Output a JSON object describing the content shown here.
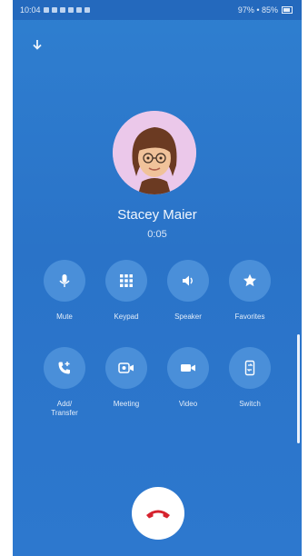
{
  "status_bar": {
    "time": "10:04",
    "right_text": "97% • 85%"
  },
  "caller": {
    "name": "Stacey Maier",
    "status": "0:05"
  },
  "controls": [
    {
      "label": "Mute",
      "icon": "microphone-icon"
    },
    {
      "label": "Keypad",
      "icon": "keypad-icon"
    },
    {
      "label": "Speaker",
      "icon": "speaker-icon"
    },
    {
      "label": "Favorites",
      "icon": "star-icon"
    },
    {
      "label": "Add/\nTransfer",
      "icon": "add-call-icon"
    },
    {
      "label": "Meeting",
      "icon": "meeting-icon"
    },
    {
      "label": "Video",
      "icon": "video-icon"
    },
    {
      "label": "Switch",
      "icon": "switch-device-icon"
    }
  ],
  "colors": {
    "background": "#2b77cc",
    "button": "#4a8fd9",
    "end_call_icon": "#d6232e"
  }
}
